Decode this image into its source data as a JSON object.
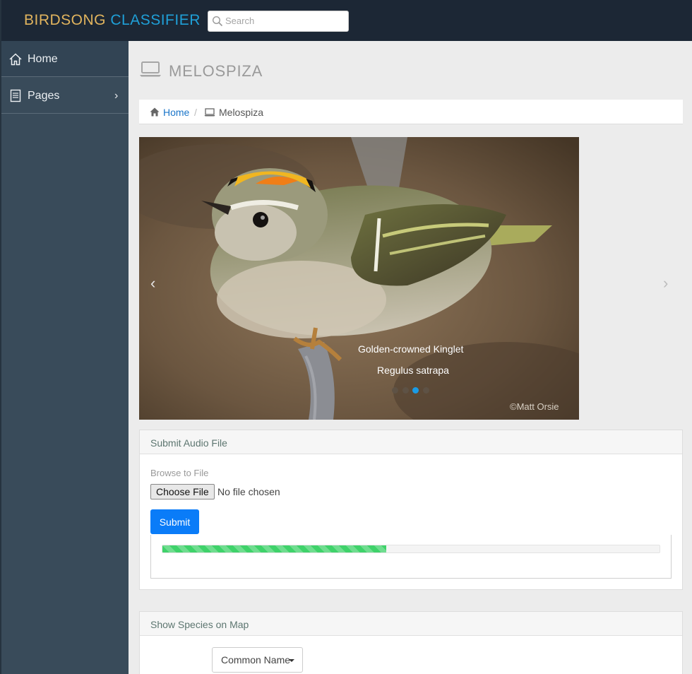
{
  "brand": {
    "part1": "BIRDSONG",
    "part2": "CLASSIFIER",
    "color1": "#e1b45e",
    "color2": "#1fa0d8"
  },
  "search": {
    "placeholder": "Search",
    "icon": "search-icon"
  },
  "sidebar": {
    "items": [
      {
        "label": "Home",
        "icon": "home-icon"
      },
      {
        "label": "Pages",
        "icon": "document-icon",
        "arrow": "›"
      }
    ]
  },
  "page": {
    "title": "MELOSPIZA",
    "icon": "laptop-icon"
  },
  "breadcrumb": {
    "home": "Home",
    "separator": "/",
    "current": "Melospiza"
  },
  "carousel": {
    "prev": "‹",
    "next": "›",
    "caption_common": "Golden-crowned Kinglet",
    "caption_scientific": "Regulus satrapa",
    "credit": "©Matt Orsie",
    "slide_count": 4,
    "active_slide": 3
  },
  "upload": {
    "heading": "Submit Audio File",
    "browse_label": "Browse to File",
    "choose_button": "Choose File",
    "file_status": "No file chosen",
    "submit": "Submit",
    "progress_percent": 45,
    "progress_color": "#3fd26a"
  },
  "map": {
    "heading": "Show Species on Map",
    "dropdown": "Common Name"
  },
  "colors": {
    "accent": "#0a7cf8",
    "link": "#1a75c9",
    "sidebar": "#394b5a",
    "topbar": "#1c2735"
  }
}
